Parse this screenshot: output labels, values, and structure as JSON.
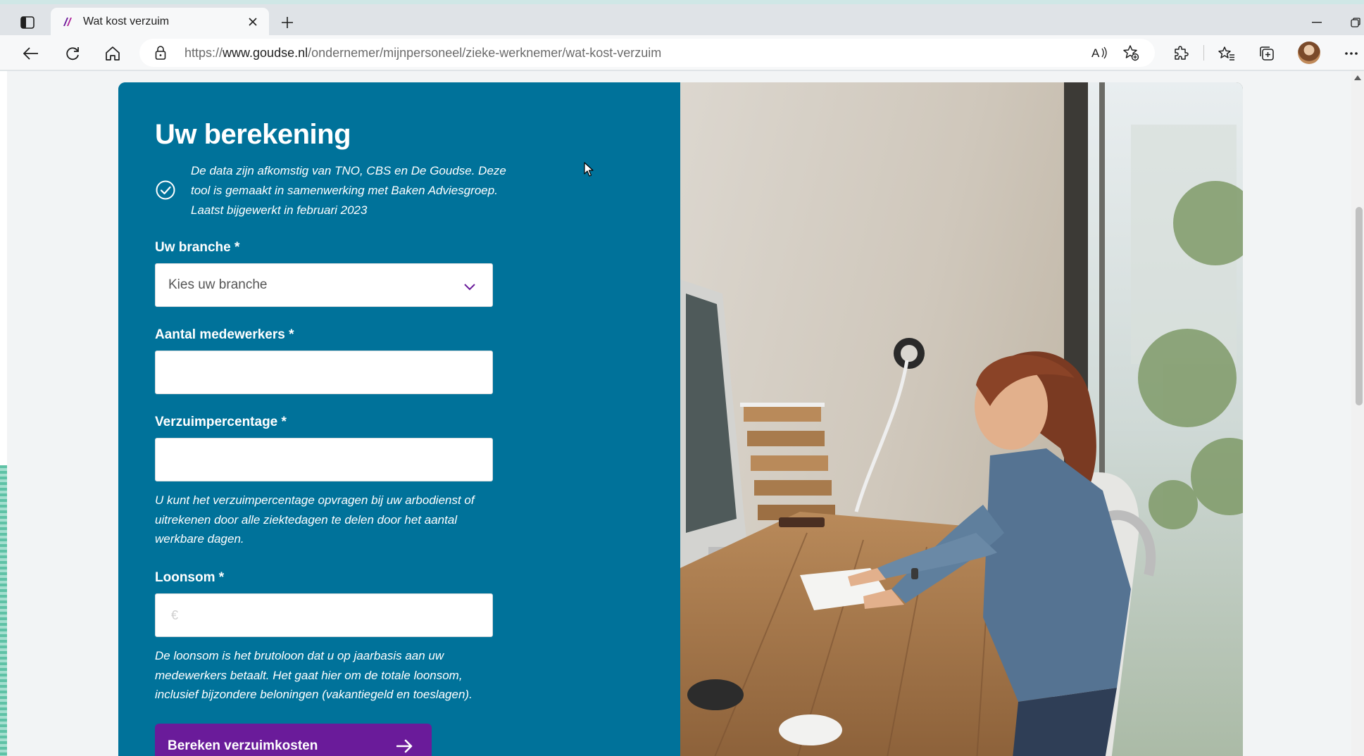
{
  "browser": {
    "tab_title": "Wat kost verzuim",
    "url_scheme": "https://",
    "url_host": "www.goudse.nl",
    "url_path": "/ondernemer/mijnpersoneel/zieke-werknemer/wat-kost-verzuim"
  },
  "calculator": {
    "title": "Uw berekening",
    "source_note": "De data zijn afkomstig van TNO, CBS en De Goudse. Deze tool is gemaakt in samenwerking met Baken Adviesgroep. Laatst bijgewerkt in februari 2023",
    "branche_label": "Uw branche *",
    "branche_value": "Kies uw branche",
    "employees_label": "Aantal medewerkers *",
    "absence_label": "Verzuimpercentage *",
    "absence_help": "U kunt het verzuimpercentage opvragen bij uw arbodienst of uitrekenen door alle ziektedagen te delen door het aantal werkbare dagen.",
    "payroll_label": "Loonsom *",
    "payroll_placeholder": "€",
    "payroll_help": "De loonsom is het brutoloon dat u op jaarbasis aan uw medewerkers betaalt. Het gaat hier om de totale loonsom, inclusief bijzondere beloningen (vakantiegeld en toeslagen).",
    "submit_label": "Bereken verzuimkosten"
  },
  "colors": {
    "panel_bg": "#00729a",
    "button_bg": "#6a1b9a",
    "chevron": "#6a1b9a"
  }
}
